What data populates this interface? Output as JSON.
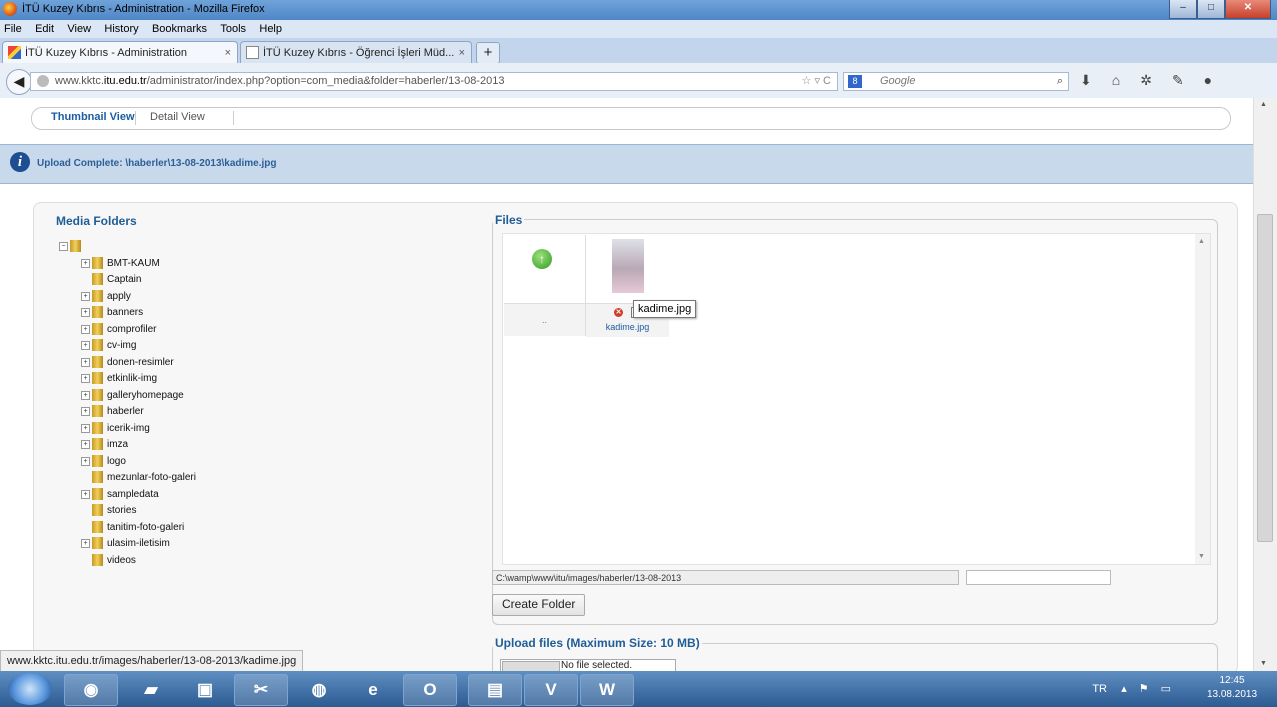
{
  "window": {
    "title": "İTÜ Kuzey Kıbrıs - Administration - Mozilla Firefox",
    "buttons": [
      "–",
      "□",
      "✕"
    ]
  },
  "menu": [
    "File",
    "Edit",
    "View",
    "History",
    "Bookmarks",
    "Tools",
    "Help"
  ],
  "tabs": [
    {
      "label": "İTÜ Kuzey Kıbrıs - Administration",
      "close": "×"
    },
    {
      "label": "İTÜ Kuzey Kıbrıs - Öğrenci İşleri Müd...",
      "close": "×"
    }
  ],
  "newtab": "+",
  "nav": {
    "back": "◀",
    "url_prefix": "www.kktc.",
    "url_domain": "itu.edu.tr",
    "url_path": "/administrator/index.php?option=com_media&folder=haberler/13-08-2013",
    "url_icons": "☆ ▿ C",
    "search_engine": "8",
    "search_placeholder": "Google",
    "search_icon": "⌕"
  },
  "view_tabs": {
    "thumbnail": "Thumbnail View",
    "detail": "Detail View"
  },
  "message": {
    "icon": "i",
    "text": "Upload Complete: \\haberler\\13-08-2013\\kadime.jpg"
  },
  "media_folders": {
    "title": "Media Folders",
    "folders": [
      {
        "name": "BMT-KAUM",
        "expandable": true
      },
      {
        "name": "Captain",
        "expandable": false
      },
      {
        "name": "apply",
        "expandable": true
      },
      {
        "name": "banners",
        "expandable": true
      },
      {
        "name": "comprofiler",
        "expandable": true
      },
      {
        "name": "cv-img",
        "expandable": true
      },
      {
        "name": "donen-resimler",
        "expandable": true
      },
      {
        "name": "etkinlik-img",
        "expandable": true
      },
      {
        "name": "galleryhomepage",
        "expandable": true
      },
      {
        "name": "haberler",
        "expandable": true
      },
      {
        "name": "icerik-img",
        "expandable": true
      },
      {
        "name": "imza",
        "expandable": true
      },
      {
        "name": "logo",
        "expandable": true
      },
      {
        "name": "mezunlar-foto-galeri",
        "expandable": false
      },
      {
        "name": "sampledata",
        "expandable": true
      },
      {
        "name": "stories",
        "expandable": false
      },
      {
        "name": "tanitim-foto-galeri",
        "expandable": false
      },
      {
        "name": "ulasim-iletisim",
        "expandable": true
      },
      {
        "name": "videos",
        "expandable": false
      }
    ]
  },
  "files": {
    "title": "Files",
    "up_label": "..",
    "items": [
      {
        "name": "kadime.jpg",
        "checked": "✓"
      }
    ],
    "tooltip": "kadime.jpg",
    "path": "C:\\wamp\\www\\itu/images/haberler/13-08-2013",
    "new_folder_value": "",
    "create_folder_button": "Create Folder"
  },
  "upload": {
    "title": "Upload files (Maximum Size: 10 MB)",
    "browse_text": "No file selected."
  },
  "status_url": "www.kktc.itu.edu.tr/images/haberler/13-08-2013/kadime.jpg",
  "taskbar": {
    "apps": [
      "firefox",
      "explorer",
      "media-player",
      "snipping-tool",
      "chrome",
      "internet-explorer",
      "outlook",
      "file-manager",
      "visio",
      "word"
    ],
    "language": "TR",
    "time": "12:45",
    "date": "13.08.2013"
  }
}
